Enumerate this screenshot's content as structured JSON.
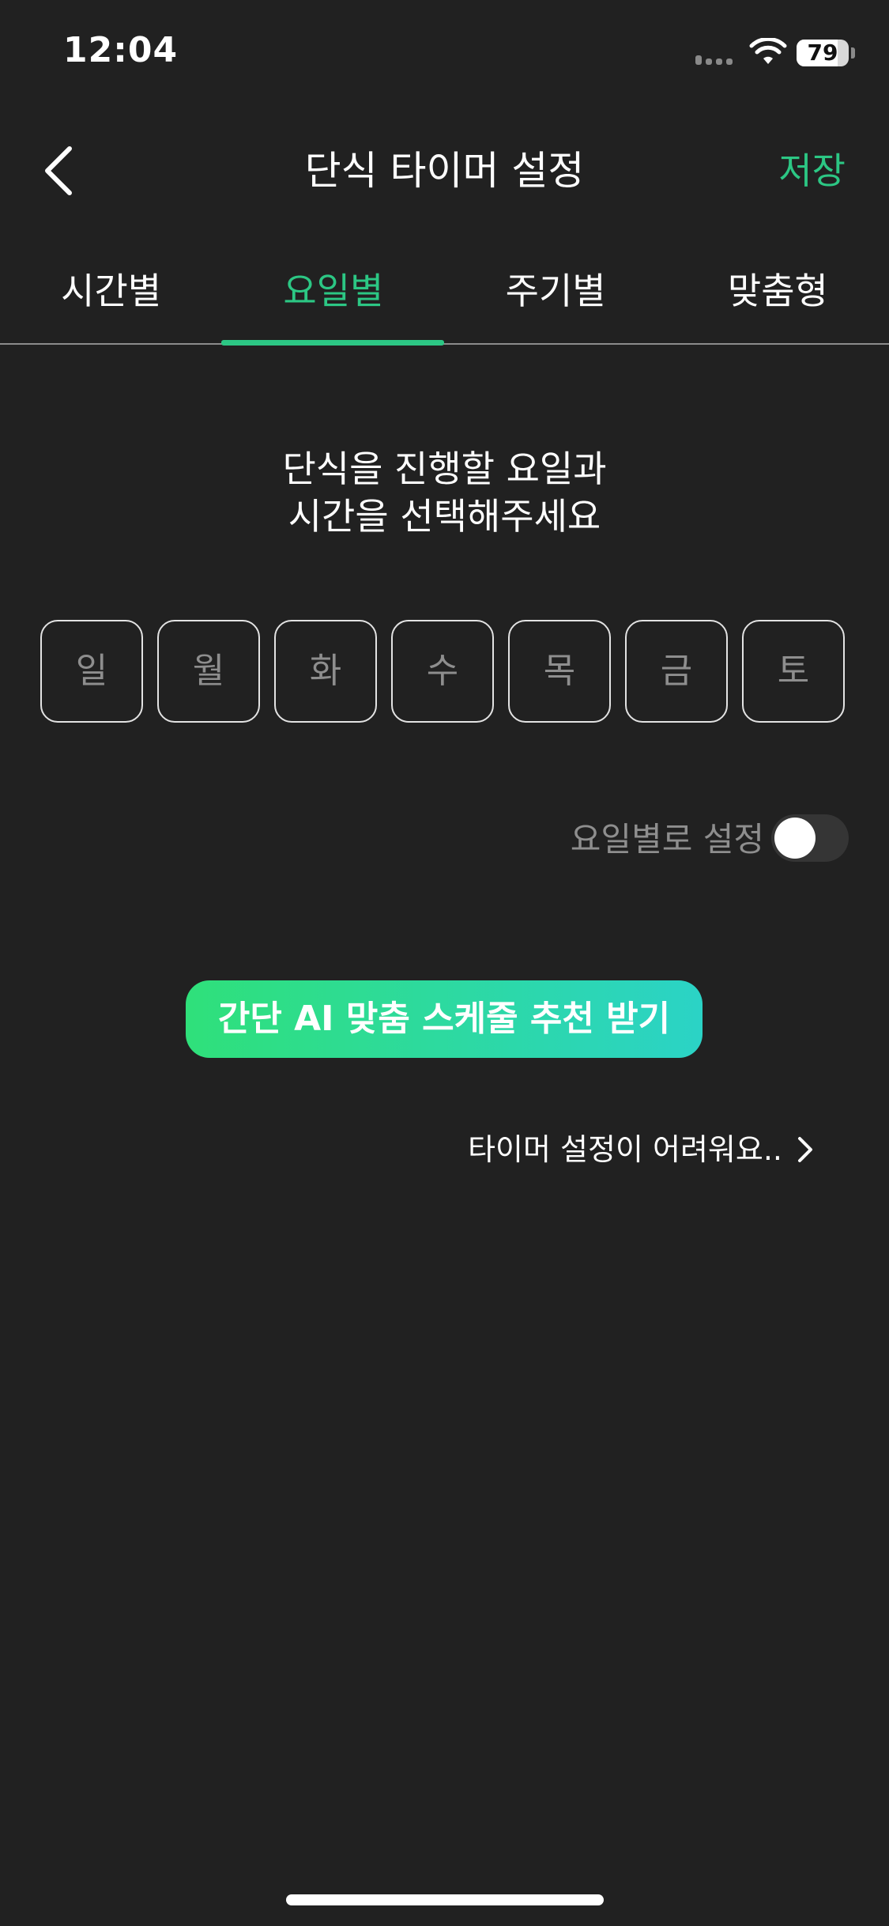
{
  "status_bar": {
    "time": "12:04",
    "battery_level": "79",
    "battery_fraction": 0.79,
    "signal_icon": "cellular-signal-icon",
    "wifi_icon": "wifi-icon"
  },
  "header": {
    "title": "단식 타이머 설정",
    "save_label": "저장",
    "back_icon": "chevron-left-icon"
  },
  "tabs": [
    {
      "label": "시간별",
      "active": false
    },
    {
      "label": "요일별",
      "active": true
    },
    {
      "label": "주기별",
      "active": false
    },
    {
      "label": "맞춤형",
      "active": false
    }
  ],
  "instruction": {
    "line1": "단식을 진행할 요일과",
    "line2": "시간을 선택해주세요"
  },
  "days": [
    "일",
    "월",
    "화",
    "수",
    "목",
    "금",
    "토"
  ],
  "day_toggle": {
    "label": "요일별로 설정",
    "on": false
  },
  "ai_button": {
    "label": "간단 AI 맞춤 스케줄 추천 받기"
  },
  "help": {
    "label": "타이머 설정이 어려워요..",
    "icon": "chevron-right-icon"
  },
  "colors": {
    "background": "#212121",
    "accent": "#2cc784",
    "gradient_start": "#2fe07a",
    "gradient_end": "#2bd3c6"
  }
}
